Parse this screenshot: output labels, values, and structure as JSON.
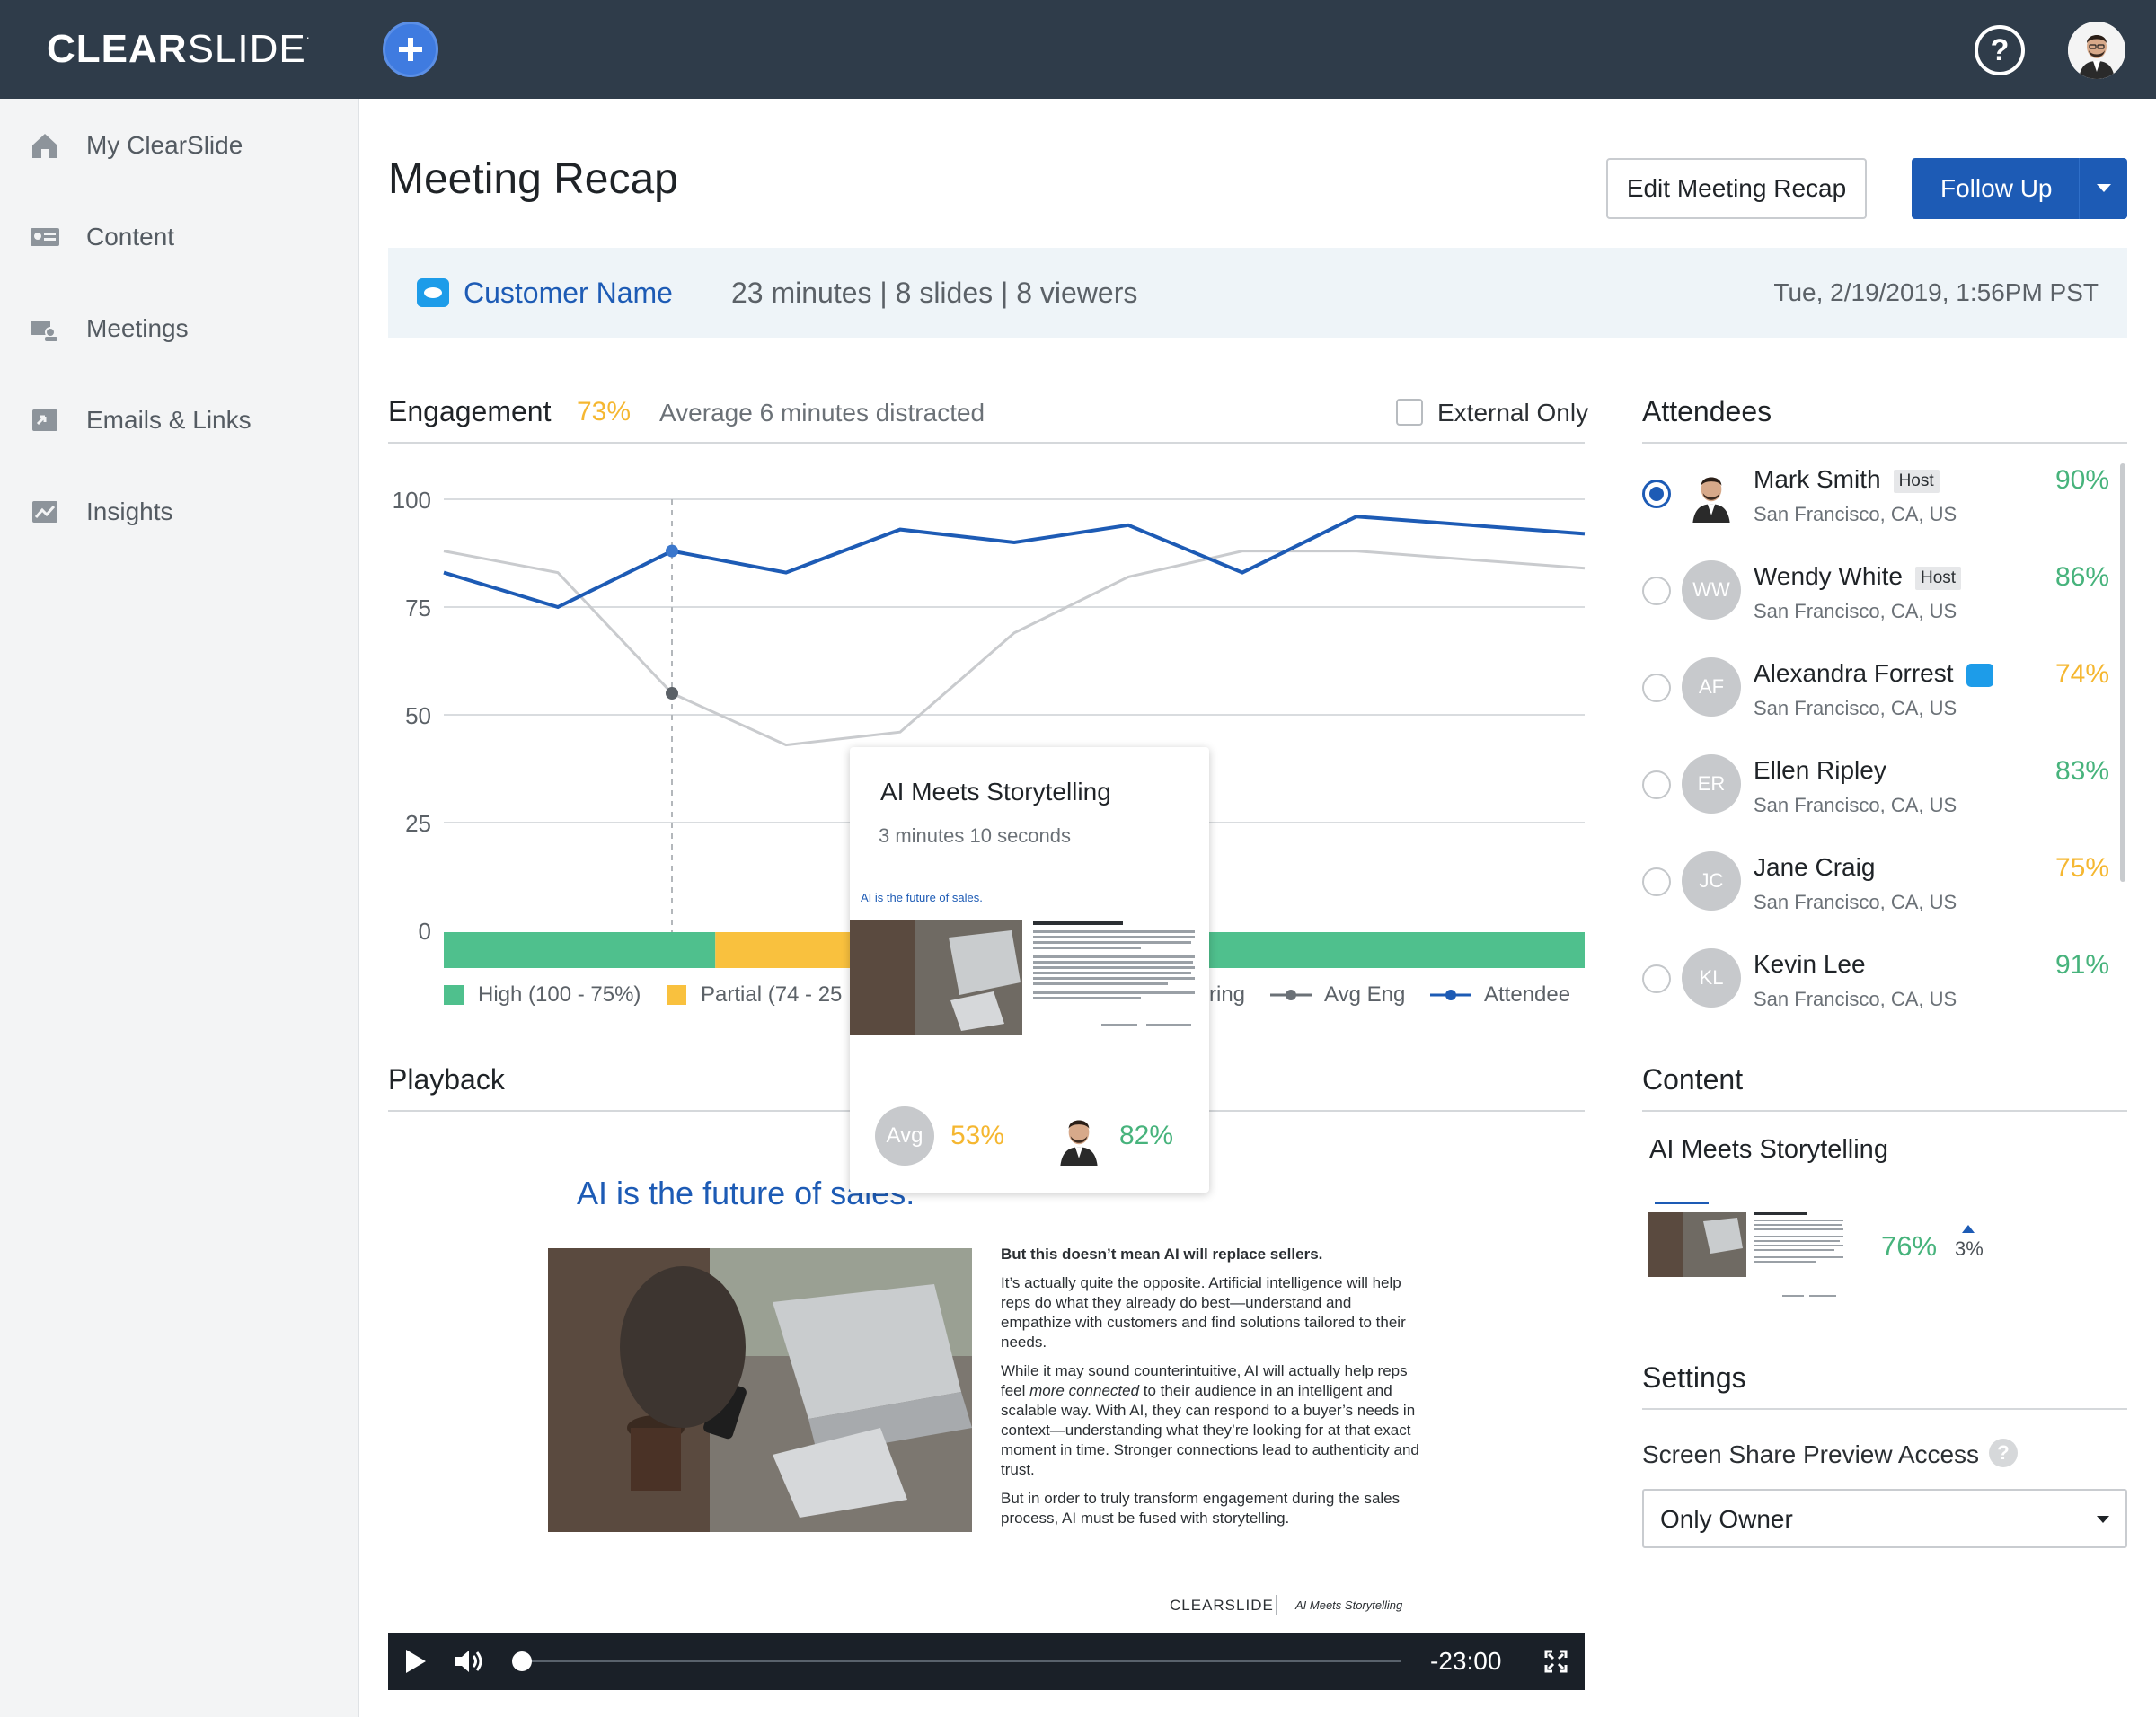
{
  "header": {
    "logo_bold": "CLEAR",
    "logo_light": "SLIDE",
    "logo_tm": "."
  },
  "sidebar": {
    "items": [
      {
        "label": "My ClearSlide",
        "icon": "home-icon"
      },
      {
        "label": "Content",
        "icon": "content-card-icon"
      },
      {
        "label": "Meetings",
        "icon": "meetings-icon"
      },
      {
        "label": "Emails & Links",
        "icon": "emails-links-icon"
      },
      {
        "label": "Insights",
        "icon": "insights-chart-icon"
      }
    ]
  },
  "page": {
    "title": "Meeting Recap",
    "edit_label": "Edit Meeting Recap",
    "follow_up_label": "Follow Up"
  },
  "summary": {
    "customer": "Customer Name",
    "meta": "23 minutes | 8 slides | 8 viewers",
    "datetime": "Tue, 2/19/2019, 1:56PM PST"
  },
  "engagement": {
    "title": "Engagement",
    "percent": "73%",
    "subtitle": "Average 6 minutes distracted",
    "external_only_label": "External Only",
    "external_only_checked": false
  },
  "chart_data": {
    "type": "line",
    "x": [
      1,
      2,
      3,
      4,
      5,
      6,
      7,
      8,
      9,
      10,
      11
    ],
    "ylim": [
      0,
      100
    ],
    "yticks": [
      "100",
      "75",
      "50",
      "25",
      "0"
    ],
    "grid": true,
    "series": [
      {
        "name": "Avg Eng",
        "color": "#c9cbce",
        "values": [
          88,
          83,
          55,
          43,
          46,
          69,
          82,
          88,
          88,
          86,
          84
        ]
      },
      {
        "name": "Attendee",
        "color": "#1d5bb5",
        "values": [
          83,
          75,
          88,
          83,
          93,
          90,
          94,
          83,
          96,
          94,
          92
        ]
      }
    ],
    "highlight_index": 2,
    "engagement_bar": [
      {
        "level": "high",
        "fraction": 0.238,
        "color": "#4fc08d"
      },
      {
        "level": "partial",
        "fraction": 0.122,
        "color": "#f9c13e"
      },
      {
        "level": "high",
        "fraction": 0.64,
        "color": "#4fc08d"
      }
    ],
    "legend": [
      {
        "label": "High (100 - 75%)",
        "kind": "square",
        "color": "#4fc08d"
      },
      {
        "label": "Partial  (74 - 25",
        "kind": "square",
        "color": "#f9c13e"
      },
      {
        "label": "ring",
        "kind": "none",
        "color": ""
      },
      {
        "label": "Avg Eng",
        "kind": "line",
        "color": "#6b7177"
      },
      {
        "label": "Attendee",
        "kind": "line",
        "color": "#1d5bb5"
      }
    ]
  },
  "tooltip": {
    "title": "AI Meets Storytelling",
    "duration": "3 minutes 10 seconds",
    "thumb_heading": "AI is the future of sales.",
    "avg_label": "Avg",
    "avg_value": "53%",
    "attendee_value": "82%"
  },
  "playback": {
    "title": "Playback",
    "slide_heading": "AI is the future of sales.",
    "text_heading": "But this doesn’t mean AI will replace sellers.",
    "para1": "It’s actually quite the opposite. Artificial intelligence will help reps do what they already do best—understand and empathize with customers and find solutions tailored to their needs.",
    "para2_a": "While it may sound counterintuitive, AI will actually help reps feel ",
    "para2_em": "more connected",
    "para2_b": " to their audience in an intelligent and scalable way. With AI, they can respond to a buyer’s needs in context—understanding what they’re looking for at that exact moment in time. Stronger connections lead to authenticity and trust.",
    "para3": "But in order to truly transform engagement during the sales process, AI must be fused with storytelling.",
    "footer_logo": "CLEARSLIDE",
    "footer_deck": "AI Meets Storytelling",
    "time_remaining": "-23:00",
    "progress": 0.0
  },
  "attendees": {
    "title": "Attendees",
    "host_label": "Host",
    "list": [
      {
        "name": "Mark Smith",
        "location": "San Francisco, CA, US",
        "score": "90%",
        "score_color": "#47b37c",
        "initials": "",
        "host": true,
        "selected": true,
        "salesforce": false
      },
      {
        "name": "Wendy White",
        "location": "San Francisco, CA, US",
        "score": "86%",
        "score_color": "#47b37c",
        "initials": "WW",
        "host": true,
        "selected": false,
        "salesforce": false
      },
      {
        "name": "Alexandra Forrest",
        "location": "San Francisco, CA, US",
        "score": "74%",
        "score_color": "#f5b731",
        "initials": "AF",
        "host": false,
        "selected": false,
        "salesforce": true
      },
      {
        "name": "Ellen Ripley",
        "location": "San Francisco, CA, US",
        "score": "83%",
        "score_color": "#47b37c",
        "initials": "ER",
        "host": false,
        "selected": false,
        "salesforce": false
      },
      {
        "name": "Jane Craig",
        "location": "San Francisco, CA, US",
        "score": "75%",
        "score_color": "#f5b731",
        "initials": "JC",
        "host": false,
        "selected": false,
        "salesforce": false
      },
      {
        "name": "Kevin Lee",
        "location": "San Francisco, CA, US",
        "score": "91%",
        "score_color": "#47b37c",
        "initials": "KL",
        "host": false,
        "selected": false,
        "salesforce": false
      }
    ]
  },
  "content": {
    "title": "Content",
    "item_name": "AI Meets Storytelling",
    "score": "76%",
    "delta": "3%",
    "delta_direction": "up"
  },
  "settings": {
    "title": "Settings",
    "screen_share_label": "Screen Share Preview Access",
    "screen_share_value": "Only Owner"
  },
  "colors": {
    "topbar": "#2f3c4a",
    "accent": "#1d5bb5",
    "high": "#4fc08d",
    "partial": "#f9c13e"
  }
}
